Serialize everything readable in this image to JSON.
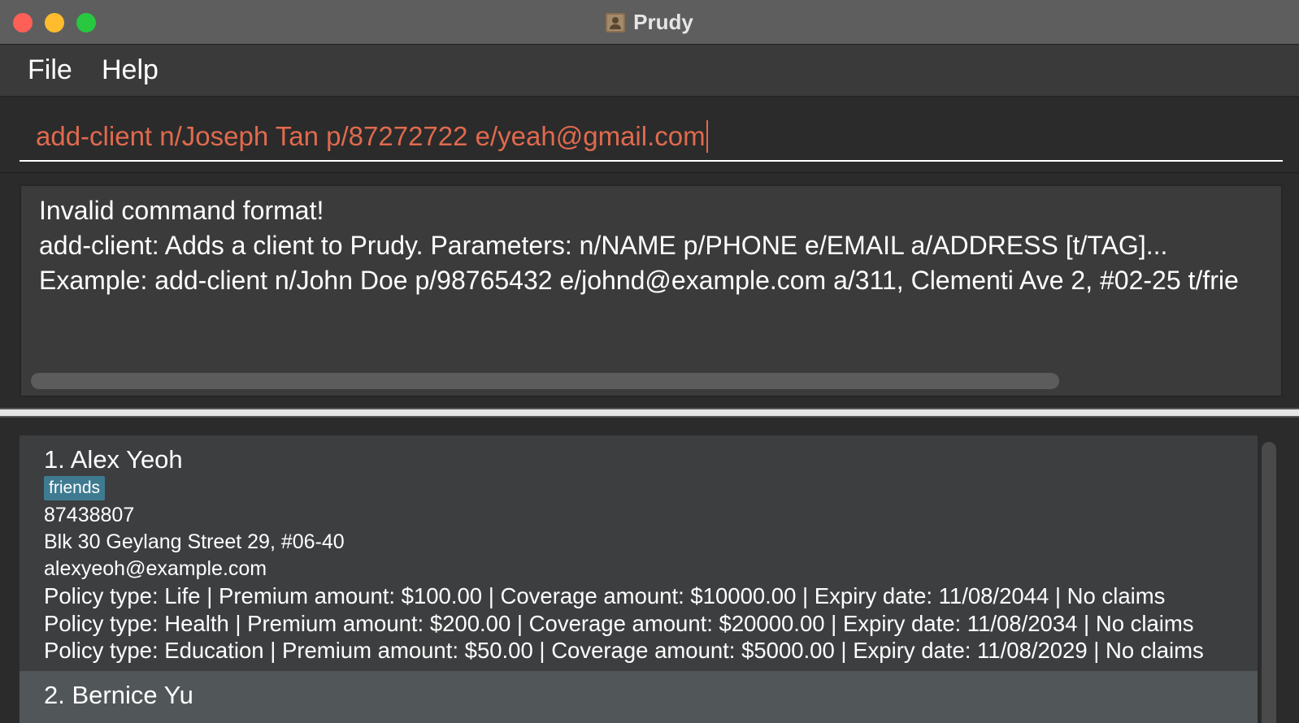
{
  "window": {
    "title": "Prudy"
  },
  "menu": {
    "file": "File",
    "help": "Help"
  },
  "command": {
    "value": "add-client n/Joseph Tan p/87272722 e/yeah@gmail.com",
    "text_color": "#e06a4e"
  },
  "result": {
    "lines": [
      "Invalid command format!",
      "add-client: Adds a client to Prudy. Parameters: n/NAME p/PHONE e/EMAIL a/ADDRESS [t/TAG]...",
      "Example: add-client n/John Doe p/98765432 e/johnd@example.com a/311, Clementi Ave 2, #02-25 t/frie"
    ]
  },
  "clients": [
    {
      "name": "1. Alex Yeoh",
      "tags": [
        "friends"
      ],
      "phone": "87438807",
      "address": "Blk 30 Geylang Street 29, #06-40",
      "email": "alexyeoh@example.com",
      "policies": [
        "Policy type: Life | Premium amount: $100.00 | Coverage amount: $10000.00 | Expiry date: 11/08/2044 | No claims",
        "Policy type: Health | Premium amount: $200.00 | Coverage amount: $20000.00 | Expiry date: 11/08/2034 | No claims",
        "Policy type: Education | Premium amount: $50.00 | Coverage amount: $5000.00 | Expiry date: 11/08/2029 | No claims"
      ]
    },
    {
      "name": "2. Bernice Yu"
    }
  ],
  "colors": {
    "tag_background": "#3e7b91",
    "selected_row": "#515659",
    "traffic_red": "#fe5f57",
    "traffic_yellow": "#febc2e",
    "traffic_green": "#28c840"
  },
  "icons": {
    "app": "contact-book-icon"
  }
}
